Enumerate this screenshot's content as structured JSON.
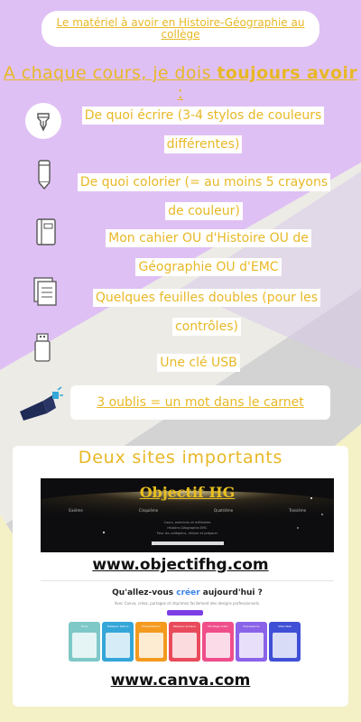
{
  "header": {
    "title": "Le matériel à avoir en Histoire-Géographie au collège"
  },
  "headline": {
    "prefix": "A chaque cours, je dois ",
    "bold": "toujours avoir",
    "suffix": " :"
  },
  "items": [
    {
      "icon": "fountain-pen-icon",
      "text": "De quoi écrire (3-4 stylos de couleurs différentes)"
    },
    {
      "icon": "pencil-icon",
      "text": "De quoi colorier (= au moins 5 crayons de couleur)"
    },
    {
      "icon": "notebook-icon",
      "text": "Mon cahier OU d'Histoire OU de Géographie OU d'EMC"
    },
    {
      "icon": "document-pages-icon",
      "text": "Quelques feuilles doubles (pour les contrôles)"
    },
    {
      "icon": "usb-key-icon",
      "text": "Une clé USB"
    }
  ],
  "callout": {
    "icon": "megaphone-icon",
    "text": "3 oublis = un mot dans le carnet"
  },
  "sites": {
    "title": "Deux sites importants",
    "site1": {
      "logo": "Objectif HG",
      "nav": [
        "Sixième",
        "Cinquième",
        "Quatrième",
        "Troisième"
      ],
      "lines": [
        "Cours, exercices et méthodes",
        "Histoire-Géographie-EMC",
        "Pour les collégiens, réviser et préparer"
      ],
      "url": "www.objectifhg.com"
    },
    "site2": {
      "question_before": "Qu'allez-vous ",
      "question_color": "créer",
      "question_after": " aujourd'hui ?",
      "subtitle": "Avec Canva, créez, partagez et imprimez facilement des designs professionnels.",
      "tiles": [
        {
          "label": "Docs",
          "color": "#7ec8c8"
        },
        {
          "label": "Tableaux blancs",
          "color": "#35a6d8"
        },
        {
          "label": "Présentations",
          "color": "#f39a1f"
        },
        {
          "label": "Réseaux sociaux",
          "color": "#e94b5c"
        },
        {
          "label": "Montage vidéo",
          "color": "#ef4e8a"
        },
        {
          "label": "Impressions",
          "color": "#8a63e8"
        },
        {
          "label": "Sites Web",
          "color": "#3f4fd6"
        }
      ],
      "url": "www.canva.com"
    }
  },
  "colors": {
    "accent": "#e8b826",
    "lilac": "#ddb7f3",
    "yellow": "#f6f0b8"
  }
}
